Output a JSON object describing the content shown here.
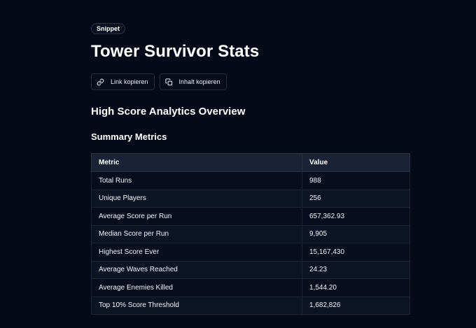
{
  "header": {
    "badge": "Snippet",
    "title": "Tower Survivor Stats"
  },
  "actions": {
    "copy_link": "Link kopieren",
    "copy_content": "Inhalt kopieren"
  },
  "section_title": "High Score Analytics Overview",
  "subsection_title": "Summary Metrics",
  "table": {
    "headers": [
      "Metric",
      "Value"
    ],
    "rows": [
      [
        "Total Runs",
        "988"
      ],
      [
        "Unique Players",
        "256"
      ],
      [
        "Average Score per Run",
        "657,362.93"
      ],
      [
        "Median Score per Run",
        "9,905"
      ],
      [
        "Highest Score Ever",
        "15,167,430"
      ],
      [
        "Average Waves Reached",
        "24.23"
      ],
      [
        "Average Enemies Killed",
        "1,544.20"
      ],
      [
        "Top 10% Score Threshold",
        "1,682,826"
      ]
    ]
  },
  "colors": {
    "background": "#050a18",
    "header_row": "#1a2335",
    "text": "#ffffff"
  }
}
